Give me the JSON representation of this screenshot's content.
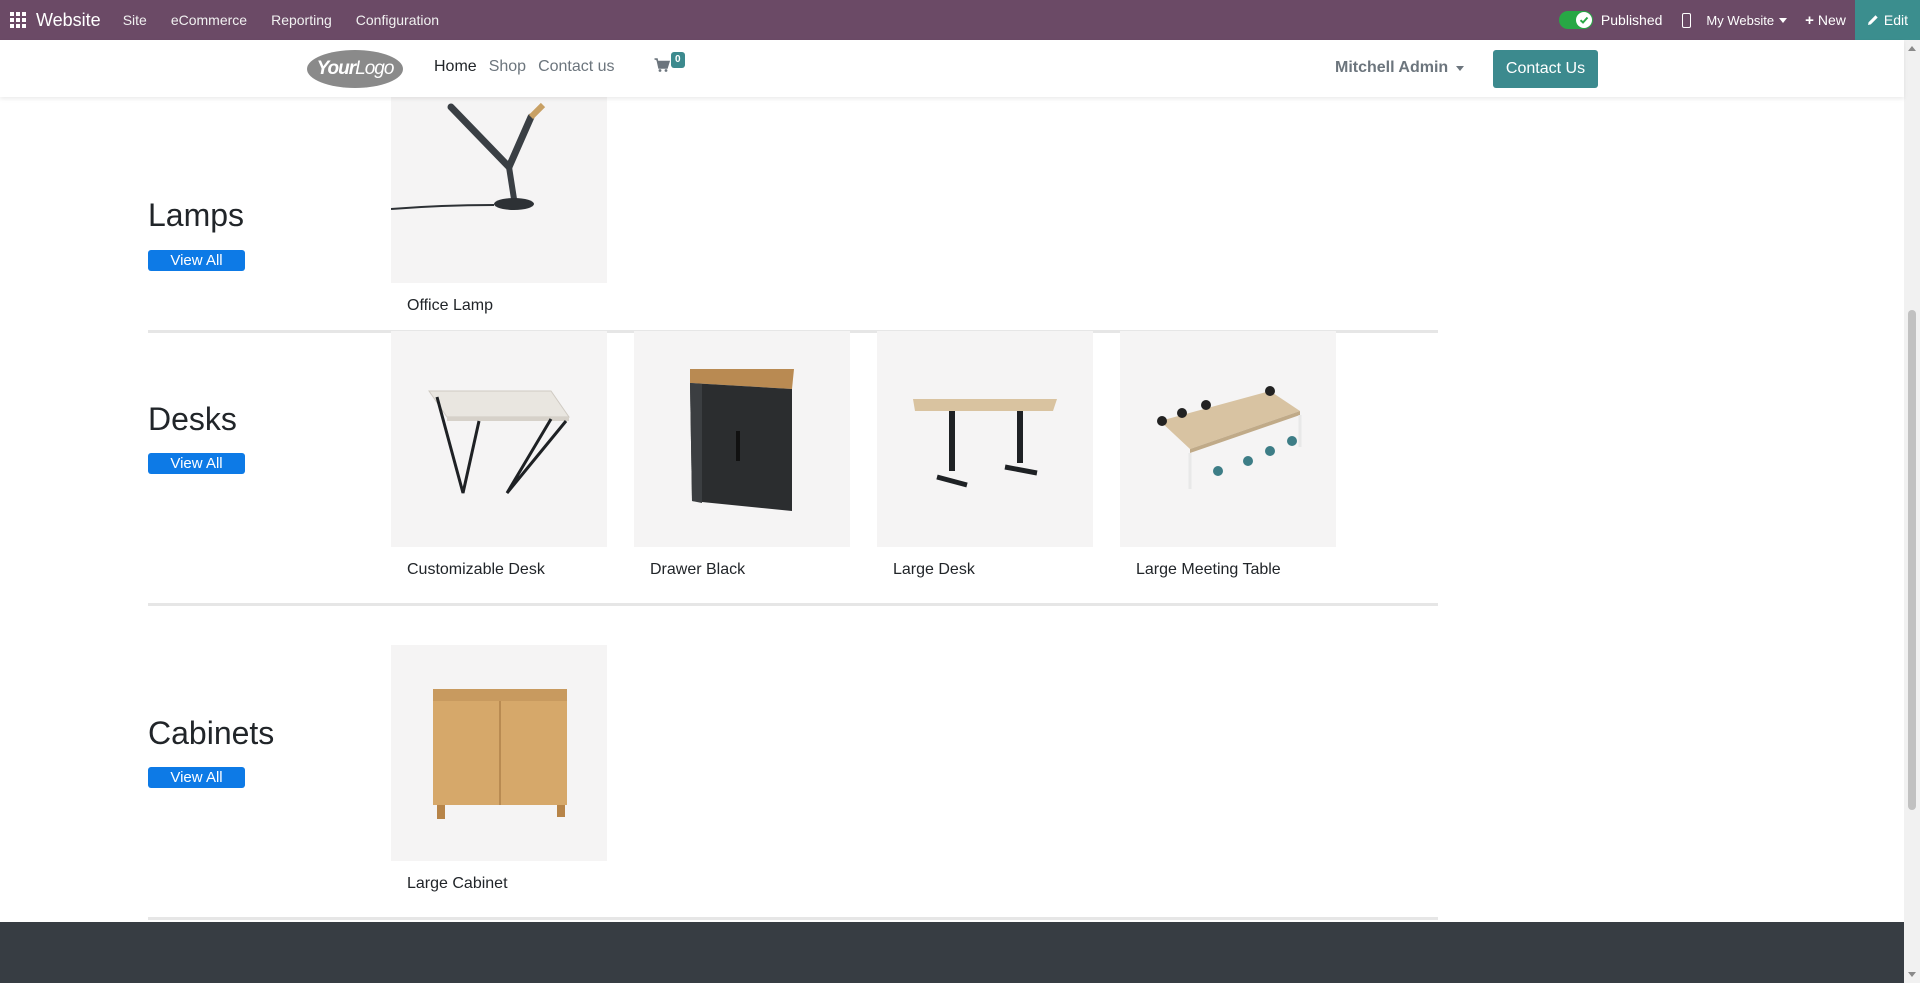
{
  "adminbar": {
    "app_name": "Website",
    "menu": [
      "Site",
      "eCommerce",
      "Reporting",
      "Configuration"
    ],
    "published_label": "Published",
    "published": true,
    "website_switcher": "My Website",
    "new_label": "New",
    "edit_label": "Edit"
  },
  "header": {
    "logo_text_bold": "Your",
    "logo_text_thin": "Logo",
    "nav": [
      "Home",
      "Shop",
      "Contact us"
    ],
    "cart_count": "0",
    "user_name": "Mitchell Admin",
    "contact_button": "Contact Us"
  },
  "categories": [
    {
      "title": "Lamps",
      "view_all": "View All",
      "products": [
        {
          "name": "Office Lamp",
          "image": "lamp"
        }
      ]
    },
    {
      "title": "Desks",
      "view_all": "View All",
      "products": [
        {
          "name": "Customizable Desk",
          "image": "desk-white"
        },
        {
          "name": "Drawer Black",
          "image": "drawer"
        },
        {
          "name": "Large Desk",
          "image": "desk-standing"
        },
        {
          "name": "Large Meeting Table",
          "image": "meeting-table"
        }
      ]
    },
    {
      "title": "Cabinets",
      "view_all": "View All",
      "products": [
        {
          "name": "Large Cabinet",
          "image": "cabinet"
        }
      ]
    }
  ],
  "colors": {
    "adminbar": "#6b4a66",
    "accent": "#3c8a8e",
    "view_all": "#0d7ae6",
    "footer": "#373d43"
  }
}
